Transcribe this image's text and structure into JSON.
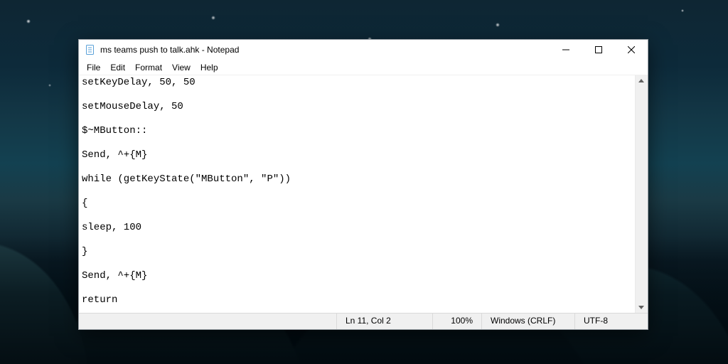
{
  "window": {
    "title": "ms teams push to talk.ahk - Notepad"
  },
  "menu": {
    "file": "File",
    "edit": "Edit",
    "format": "Format",
    "view": "View",
    "help": "Help"
  },
  "editor": {
    "content": "setKeyDelay, 50, 50\n\nsetMouseDelay, 50\n\n$~MButton::\n\nSend, ^+{M}\n\nwhile (getKeyState(\"MButton\", \"P\"))\n\n{\n\nsleep, 100\n\n}\n\nSend, ^+{M}\n\nreturn"
  },
  "status": {
    "lncol": "Ln 11, Col 2",
    "zoom": "100%",
    "eol": "Windows (CRLF)",
    "encoding": "UTF-8"
  },
  "icons": {
    "app": "notepad-icon",
    "minimize": "minimize-icon",
    "maximize": "maximize-icon",
    "close": "close-icon",
    "scroll": "vertical-scrollbar"
  }
}
